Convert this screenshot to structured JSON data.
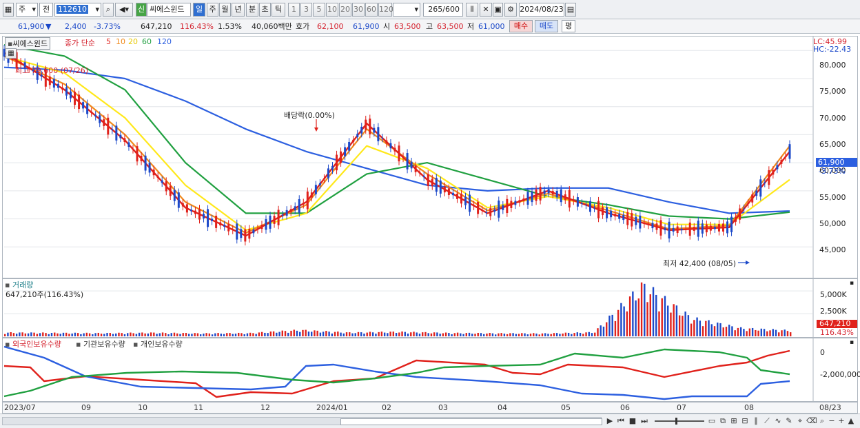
{
  "toolbar": {
    "period": "주",
    "compare": "전",
    "code": "112610",
    "stock_badge": "신",
    "stock_name": "씨에스윈드",
    "timeframes": [
      "일",
      "주",
      "월",
      "년",
      "분",
      "초",
      "틱"
    ],
    "active_timeframe": "일",
    "intervals": [
      "1",
      "3",
      "5",
      "10",
      "20",
      "30",
      "60",
      "120"
    ],
    "count_display": "265",
    "count_max": "/600",
    "date": "2024/08/23"
  },
  "quote": {
    "price": "61,900",
    "arrow": "▼",
    "change": "2,400",
    "change_pct": "-3.73%",
    "volume": "647,210",
    "volume_ratio": "116.43%",
    "turnover": "1.53%",
    "trade_value": "40,060백만",
    "ask_label": "호가",
    "ask1": "62,100",
    "ask2": "61,900",
    "open_label": "시",
    "open": "63,500",
    "high_label": "고",
    "high": "63,500",
    "low_label": "저",
    "low": "61,000",
    "buy_button": "매수",
    "sell_button": "매도",
    "eval_button": "평"
  },
  "price_pane": {
    "stock_tab": "씨에스윈드",
    "legend_label": "종가 단순",
    "ma_periods": [
      "5",
      "10",
      "20",
      "60",
      "120"
    ],
    "ma_colors": [
      "#e0211b",
      "#f08a1c",
      "#ffe81a",
      "#20a040",
      "#2c5fe0"
    ],
    "lc": "LC:45.99",
    "hc": "HC:-22.43",
    "high_note": "최고 79,600 (07/26)",
    "low_note": "최저 42,400 (08/05)",
    "dividend_note": "배당락(0.00%)",
    "current_price": "61,900",
    "current_change": "-3.73%",
    "y_ticks": [
      "80,000",
      "75,000",
      "70,000",
      "65,000",
      "60,000",
      "55,000",
      "50,000",
      "45,000"
    ]
  },
  "volume_pane": {
    "title": "거래량",
    "value": "647,210주(116.43%)",
    "y_ticks": [
      "5,000K",
      "2,500K"
    ],
    "current": "647,210",
    "current_pct": "116.43%"
  },
  "holder_pane": {
    "legend": [
      "외국인보유수량",
      "기관보유수량",
      "개인보유수량"
    ],
    "legend_colors": [
      "#e0211b",
      "#2c5fe0",
      "#20a040"
    ],
    "y_ticks": [
      "0",
      "-2,000,000"
    ]
  },
  "x_axis": {
    "labels": [
      "2023/07",
      "09",
      "10",
      "11",
      "12",
      "2024/01",
      "02",
      "03",
      "04",
      "05",
      "06",
      "07",
      "08"
    ],
    "right_label": "08/23"
  },
  "chart_data": {
    "type": "line",
    "title": "",
    "xlabel": "",
    "ylabel": "",
    "ylim": [
      40000,
      82000
    ],
    "x": [
      "2023/07",
      "09",
      "10",
      "11",
      "12",
      "2024/01",
      "02",
      "03",
      "04",
      "05",
      "06",
      "07",
      "08"
    ],
    "series": [
      {
        "name": "5",
        "values": [
          79600,
          73000,
          64000,
          52000,
          47000,
          53000,
          67000,
          57000,
          51000,
          55000,
          51000,
          48000,
          48500,
          62000
        ]
      },
      {
        "name": "10",
        "values": [
          79000,
          74000,
          65000,
          53000,
          47500,
          52500,
          66000,
          58000,
          51500,
          54500,
          51500,
          48200,
          48800,
          63000
        ]
      },
      {
        "name": "20",
        "values": [
          79000,
          76000,
          68000,
          56000,
          48000,
          51000,
          63000,
          59000,
          52000,
          54000,
          52000,
          49000,
          49000,
          57000
        ]
      },
      {
        "name": "60",
        "values": [
          81000,
          79000,
          73000,
          60000,
          51000,
          51000,
          58000,
          60000,
          57000,
          54000,
          52500,
          50500,
          50000,
          51200
        ]
      },
      {
        "name": "120",
        "values": [
          77000,
          76500,
          75000,
          71000,
          66000,
          62000,
          59000,
          56000,
          55000,
          55500,
          55500,
          53000,
          51000,
          51400
        ]
      }
    ],
    "volume": {
      "name": "거래량",
      "values": [
        420,
        380,
        350,
        400,
        330,
        360,
        700,
        420,
        500,
        380,
        340,
        320,
        450,
        5700,
        2000,
        900,
        647
      ]
    }
  }
}
